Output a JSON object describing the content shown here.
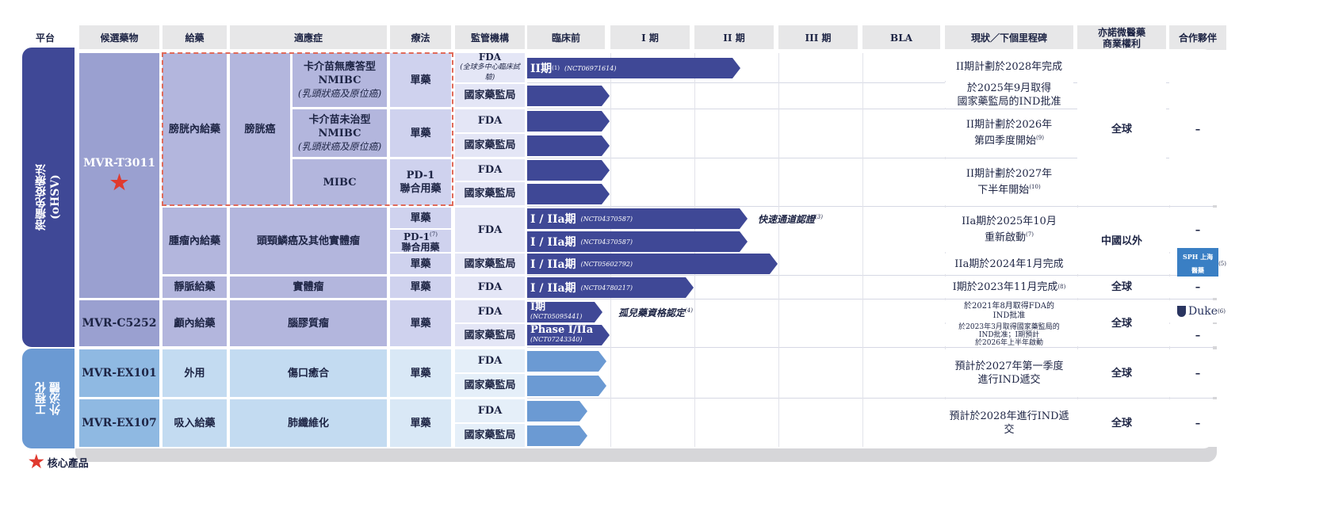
{
  "headers": {
    "platform": "平台",
    "candidate": "候選藥物",
    "admin": "給藥",
    "indication": "適應症",
    "therapy": "療法",
    "regulator": "監管機構",
    "preclinical": "臨床前",
    "phase1": "I 期",
    "phase2": "II 期",
    "phase3": "III 期",
    "bla": "BLA",
    "status": "現狀／下個里程碑",
    "rights_l1": "亦諾微醫藥",
    "rights_l2": "商業權利",
    "partner": "合作夥伴"
  },
  "platforms": {
    "ohsv_l1": "溶瘤免疫療法",
    "ohsv_l2": "(oHSV)",
    "exo_l1": "工程化",
    "exo_l2": "外泌體"
  },
  "candidates": {
    "t3011": "MVR-T3011",
    "c5252": "MVR-C5252",
    "ex101": "MVR-EX101",
    "ex107": "MVR-EX107"
  },
  "admin": {
    "intravesical": "膀胱內給藥",
    "intratumoral": "腫瘤內給藥",
    "iv": "靜脈給藥",
    "intracranial": "顱內給藥",
    "topical": "外用",
    "inhaled": "吸入給藥"
  },
  "indications": {
    "bladder": "膀胱癌",
    "bcg_unresp": "卡介苗無應答型NMIBC",
    "bcg_unresp_sub": "(乳頭狀癌及原位癌)",
    "bcg_naive": "卡介苗未治型NMIBC",
    "bcg_naive_sub": "(乳頭狀癌及原位癌)",
    "mibc": "MIBC",
    "hnscc": "頭頸鱗癌及其他實體瘤",
    "solid": "實體瘤",
    "glioma": "腦膠質瘤",
    "wound": "傷口癒合",
    "fibrosis": "肺纖維化"
  },
  "therapy": {
    "mono": "單藥",
    "combo_l1": "PD-1",
    "combo_l2": "聯合用藥",
    "combo7_l1": "PD-1",
    "combo7_sup": "(7)"
  },
  "regulators": {
    "fda": "FDA",
    "fda_global": "(全球多中心臨床試驗)",
    "nmpa": "國家藥監局"
  },
  "bars": {
    "r1_label": "II期",
    "r1_sup": "(1)",
    "r1_nct": "(NCT06971614)",
    "r7_label": "I / IIa期",
    "r7_nct": "(NCT04370587)",
    "r8_label": "I / IIa期",
    "r8_nct": "(NCT04370587)",
    "r9_label": "I / IIa期",
    "r9_nct": "(NCT05602792)",
    "r10_label": "I / IIa期",
    "r10_nct": "(NCT04780217)",
    "r11_label": "I期",
    "r11_nct": "(NCT05095441)",
    "r12_label": "Phase I/IIa",
    "r12_nct": "(NCT07243340)",
    "fast_track": "快速通道認證",
    "fast_track_sup": "(3)",
    "orphan": "孤兒藥資格認定",
    "orphan_sup": "(4)"
  },
  "status": {
    "s1": "II期計劃於2028年完成",
    "s2_l1": "於2025年9月取得",
    "s2_l2": "國家藥監局的IND批准",
    "s3_l1": "II期計劃於2026年",
    "s3_l2": "第四季度開始",
    "s3_sup": "(9)",
    "s4_l1": "II期計劃於2027年",
    "s4_l2": "下半年開始",
    "s4_sup": "(10)",
    "s5_l1": "IIa期於2025年10月",
    "s5_l2": "重新啟動",
    "s5_sup": "(7)",
    "s6": "IIa期於2024年1月完成",
    "s7": "I期於2023年11月完成",
    "s7_sup": "(8)",
    "s8_l1": "於2021年8月取得FDA的",
    "s8_l2": "IND批准",
    "s9_l1": "於2023年3月取得國家藥監局的",
    "s9_l2": "IND批准；I期預計",
    "s9_l3": "於2026年上半年啟動",
    "s10_l1": "預計於2027年第一季度",
    "s10_l2": "進行IND遞交",
    "s11": "預計於2028年進行IND遞交"
  },
  "rights": {
    "global": "全球",
    "ex_china": "中國以外"
  },
  "partners": {
    "dash": "–",
    "sph_logo": "SPH 上海醫藥",
    "sph_sup": "(5)",
    "duke_logo": "Duke",
    "duke_sup": "(6)"
  },
  "legend": {
    "core": "核心產品"
  },
  "colors": {
    "dark_bar": "#3f4896",
    "light_bar": "#6b9ad3",
    "ohsv_band": "#3f4896",
    "exo_band": "#6b9ad3",
    "star": "#e03a2f",
    "dashed_box": "#e06a5a"
  },
  "chart_data": {
    "type": "pipeline",
    "stages": [
      "臨床前",
      "I 期",
      "II 期",
      "III 期",
      "BLA"
    ],
    "programs": [
      {
        "candidate": "MVR-T3011",
        "indication": "卡介苗無應答型NMIBC",
        "regulator": "FDA",
        "stage_progress": 2.6
      },
      {
        "candidate": "MVR-T3011",
        "indication": "卡介苗無應答型NMIBC",
        "regulator": "國家藥監局",
        "stage_progress": 1.0
      },
      {
        "candidate": "MVR-T3011",
        "indication": "卡介苗未治型NMIBC",
        "regulator": "FDA",
        "stage_progress": 1.0
      },
      {
        "candidate": "MVR-T3011",
        "indication": "卡介苗未治型NMIBC",
        "regulator": "國家藥監局",
        "stage_progress": 1.0
      },
      {
        "candidate": "MVR-T3011",
        "indication": "MIBC",
        "regulator": "FDA",
        "stage_progress": 1.0
      },
      {
        "candidate": "MVR-T3011",
        "indication": "MIBC",
        "regulator": "國家藥監局",
        "stage_progress": 1.0
      },
      {
        "candidate": "MVR-T3011",
        "indication": "頭頸鱗癌及其他實體瘤",
        "regulator": "FDA",
        "stage_progress": 2.7
      },
      {
        "candidate": "MVR-T3011",
        "indication": "頭頸鱗癌及其他實體瘤",
        "regulator": "FDA",
        "stage_progress": 2.7
      },
      {
        "candidate": "MVR-T3011",
        "indication": "頭頸鱗癌及其他實體瘤",
        "regulator": "國家藥監局",
        "stage_progress": 3.1
      },
      {
        "candidate": "MVR-T3011",
        "indication": "實體瘤",
        "regulator": "FDA",
        "stage_progress": 2.1
      },
      {
        "candidate": "MVR-C5252",
        "indication": "腦膠質瘤",
        "regulator": "FDA",
        "stage_progress": 0.9
      },
      {
        "candidate": "MVR-C5252",
        "indication": "腦膠質瘤",
        "regulator": "國家藥監局",
        "stage_progress": 1.0
      },
      {
        "candidate": "MVR-EX101",
        "indication": "傷口癒合",
        "regulator": "FDA",
        "stage_progress": 1.0
      },
      {
        "candidate": "MVR-EX101",
        "indication": "傷口癒合",
        "regulator": "國家藥監局",
        "stage_progress": 1.0
      },
      {
        "candidate": "MVR-EX107",
        "indication": "肺纖維化",
        "regulator": "FDA",
        "stage_progress": 0.75
      },
      {
        "candidate": "MVR-EX107",
        "indication": "肺纖維化",
        "regulator": "國家藥監局",
        "stage_progress": 0.75
      }
    ]
  }
}
